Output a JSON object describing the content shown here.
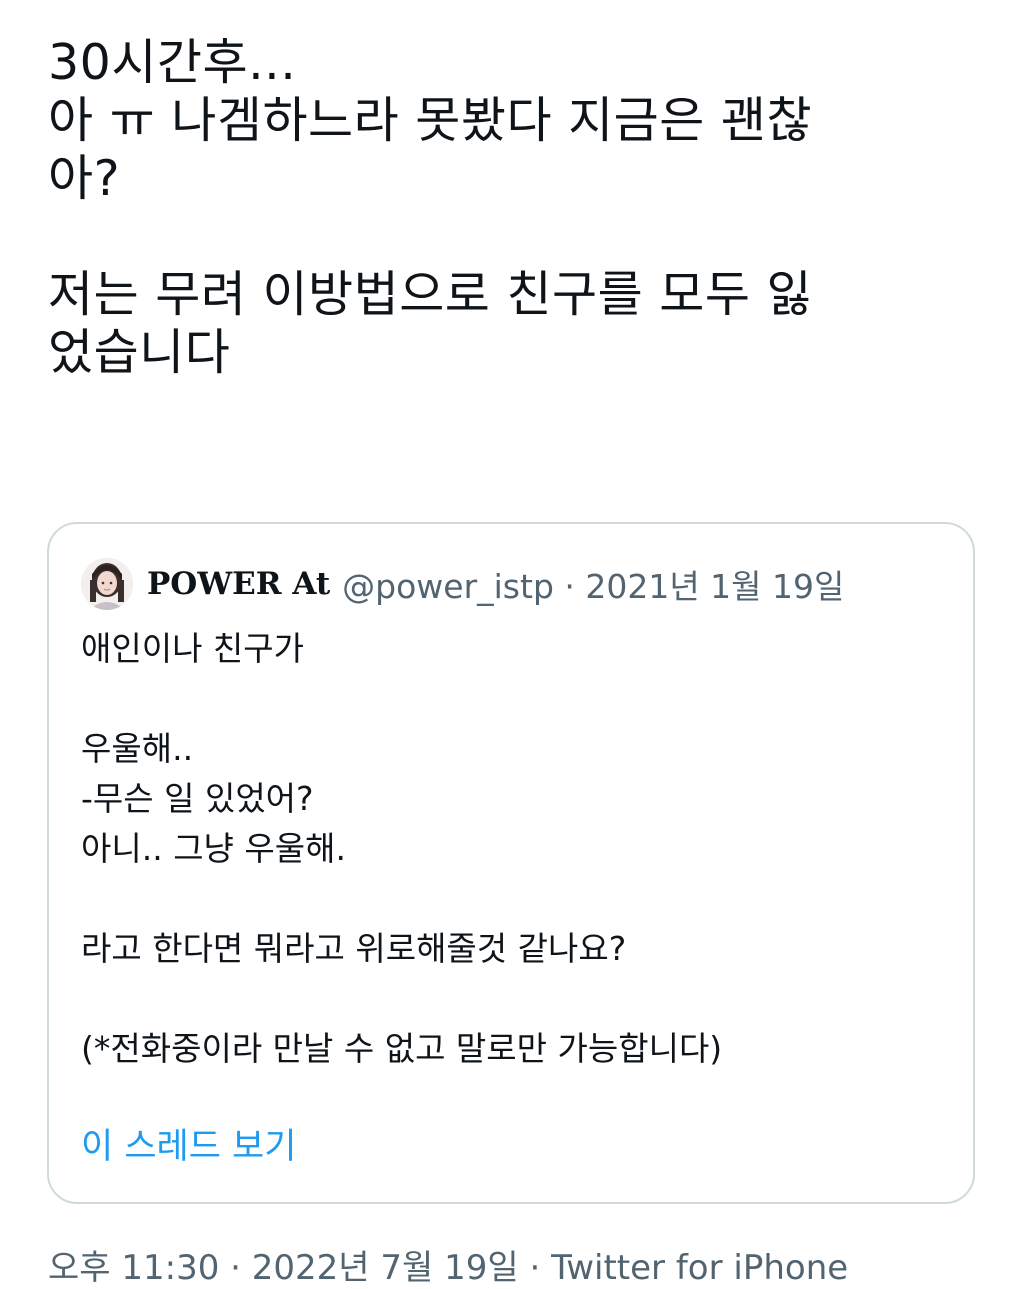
{
  "tweet": {
    "lines": [
      "30시간후...",
      "아 ㅠ 나겜하느라 못봤다 지금은 괜찮",
      "아?",
      "",
      "저는 무려 이방법으로 친구를 모두 잃",
      "었습니다"
    ]
  },
  "quote": {
    "display_name": "POWER At",
    "meta": "@power_istp · 2021년 1월 19일",
    "body_lines": [
      "애인이나 친구가",
      "",
      "우울해..",
      "-무슨 일 있었어?",
      "아니.. 그냥 우울해.",
      "",
      "라고 한다면 뭐라고 위로해줄것 같나요?",
      "",
      "(*전화중이라 만날 수 없고 말로만 가능합니다)"
    ],
    "thread_link": "이 스레드 보기"
  },
  "footer": {
    "meta": "오후 11:30 · 2022년 7월 19일 · Twitter for iPhone"
  },
  "colors": {
    "text": "#0f1419",
    "secondary": "#536471",
    "link": "#1d9bf0",
    "border": "#cfd9de"
  }
}
